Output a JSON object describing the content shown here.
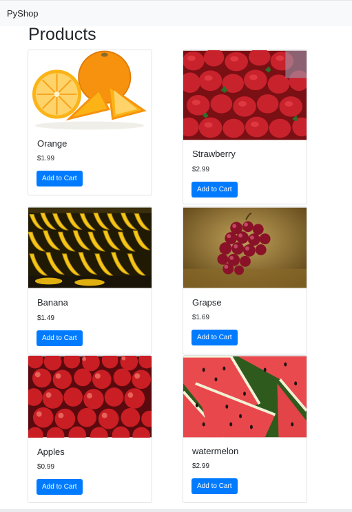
{
  "navbar": {
    "brand": "PyShop"
  },
  "page": {
    "title": "Products"
  },
  "products": [
    {
      "name": "Orange",
      "price": "$1.99",
      "button": "Add to Cart"
    },
    {
      "name": "Strawberry",
      "price": "$2.99",
      "button": "Add to Cart"
    },
    {
      "name": "Banana",
      "price": "$1.49",
      "button": "Add to Cart"
    },
    {
      "name": "Grapse",
      "price": "$1.69",
      "button": "Add to Cart"
    },
    {
      "name": "Apples",
      "price": "$0.99",
      "button": "Add to Cart"
    },
    {
      "name": "watermelon",
      "price": "$2.99",
      "button": "Add to Cart"
    }
  ],
  "colors": {
    "primary": "#007bff",
    "navbar_bg": "#f8f9fa"
  }
}
